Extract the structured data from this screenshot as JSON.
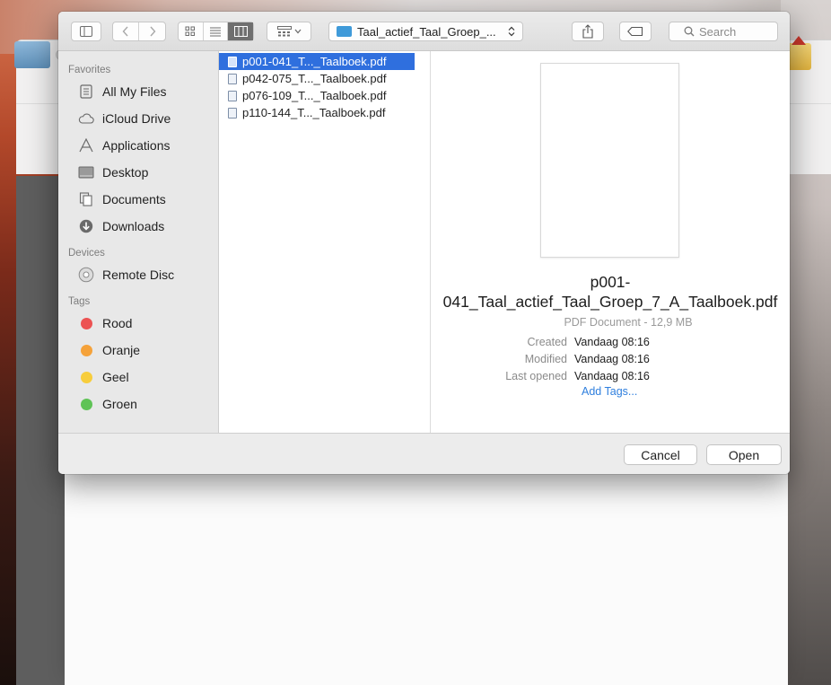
{
  "toolbar": {
    "path_label": "Taal_actief_Taal_Groep_...",
    "search_placeholder": "Search"
  },
  "sidebar": {
    "sections": [
      {
        "title": "Favorites",
        "items": [
          {
            "label": "All My Files",
            "icon": "all-files-icon"
          },
          {
            "label": "iCloud Drive",
            "icon": "cloud-icon"
          },
          {
            "label": "Applications",
            "icon": "applications-icon"
          },
          {
            "label": "Desktop",
            "icon": "desktop-icon"
          },
          {
            "label": "Documents",
            "icon": "documents-icon"
          },
          {
            "label": "Downloads",
            "icon": "downloads-icon"
          }
        ]
      },
      {
        "title": "Devices",
        "items": [
          {
            "label": "Remote Disc",
            "icon": "disc-icon"
          }
        ]
      },
      {
        "title": "Tags",
        "items": [
          {
            "label": "Rood",
            "color": "#ec5252"
          },
          {
            "label": "Oranje",
            "color": "#f5a23a"
          },
          {
            "label": "Geel",
            "color": "#f7cd3c"
          },
          {
            "label": "Groen",
            "color": "#5fc356"
          }
        ]
      }
    ]
  },
  "files": [
    {
      "name": "p001-041_T..._Taalboek.pdf",
      "selected": true
    },
    {
      "name": "p042-075_T..._Taalboek.pdf",
      "selected": false
    },
    {
      "name": "p076-109_T..._Taalboek.pdf",
      "selected": false
    },
    {
      "name": "p110-144_T..._Taalboek.pdf",
      "selected": false
    }
  ],
  "preview": {
    "filename": "p001-041_Taal_actief_Taal_Groep_7_A_Taalboek.pdf",
    "kind": "PDF Document - 12,9 MB",
    "meta": [
      {
        "key": "Created",
        "value": "Vandaag 08:16"
      },
      {
        "key": "Modified",
        "value": "Vandaag 08:16"
      },
      {
        "key": "Last opened",
        "value": "Vandaag 08:16"
      }
    ],
    "add_tags": "Add Tags..."
  },
  "footer": {
    "cancel_label": "Cancel",
    "open_label": "Open"
  }
}
